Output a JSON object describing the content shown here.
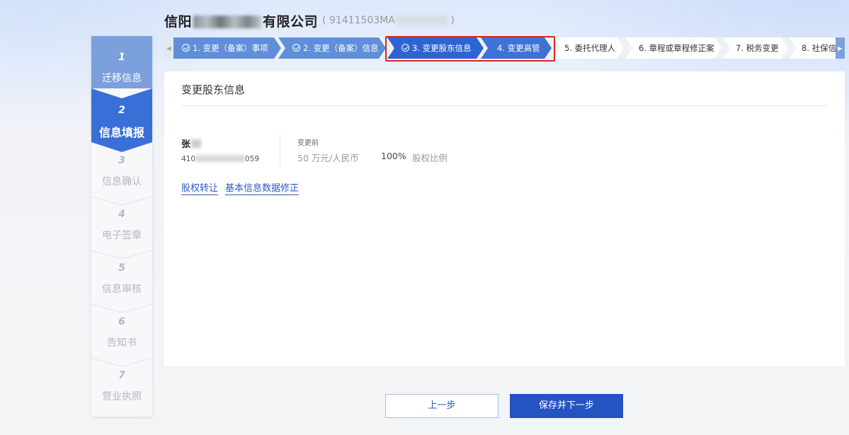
{
  "header": {
    "company_prefix": "信阳",
    "company_suffix": "有限公司",
    "code_open": "( 91411503MA",
    "code_close": " )"
  },
  "left_steps": [
    {
      "num": "1",
      "label": "迁移信息",
      "state": "done"
    },
    {
      "num": "2",
      "label": "信息填报",
      "state": "active"
    },
    {
      "num": "3",
      "label": "信息确认",
      "state": "pending"
    },
    {
      "num": "4",
      "label": "电子签章",
      "state": "pending"
    },
    {
      "num": "5",
      "label": "信息审核",
      "state": "pending"
    },
    {
      "num": "6",
      "label": "告知书",
      "state": "pending"
    },
    {
      "num": "7",
      "label": "营业执照",
      "state": "pending"
    }
  ],
  "top_tabs": [
    {
      "label": "1. 变更（备案）事项",
      "state": "done"
    },
    {
      "label": "2. 变更（备案）信息",
      "state": "done"
    },
    {
      "label": "3. 变更股东信息",
      "state": "active"
    },
    {
      "label": "4. 变更高管",
      "state": "active"
    },
    {
      "label": "5. 委托代理人",
      "state": "pending"
    },
    {
      "label": "6. 章程或章程修正案",
      "state": "pending"
    },
    {
      "label": "7. 税务变更",
      "state": "pending"
    },
    {
      "label": "8. 社保信",
      "state": "pending"
    }
  ],
  "panel": {
    "title": "变更股东信息",
    "shareholder": {
      "name_prefix": "张",
      "id_prefix": "410",
      "id_suffix": "059",
      "before_label": "变更前",
      "capital": "50 万元/人民币",
      "ratio": "100%",
      "ratio_label": "股权比例"
    },
    "links": {
      "transfer": "股权转让",
      "correction": "基本信息数据修正"
    }
  },
  "footer": {
    "prev_label": "上一步",
    "next_label": "保存并下一步"
  },
  "colors": {
    "done": "#7ba0dc",
    "active": "#3a6fd8",
    "primary_button": "#2453c2",
    "highlight": "#e02020"
  },
  "icons": {
    "check": "check-circle-icon",
    "scroll_left": "chevron-left-icon",
    "scroll_right": "chevron-right-icon"
  }
}
